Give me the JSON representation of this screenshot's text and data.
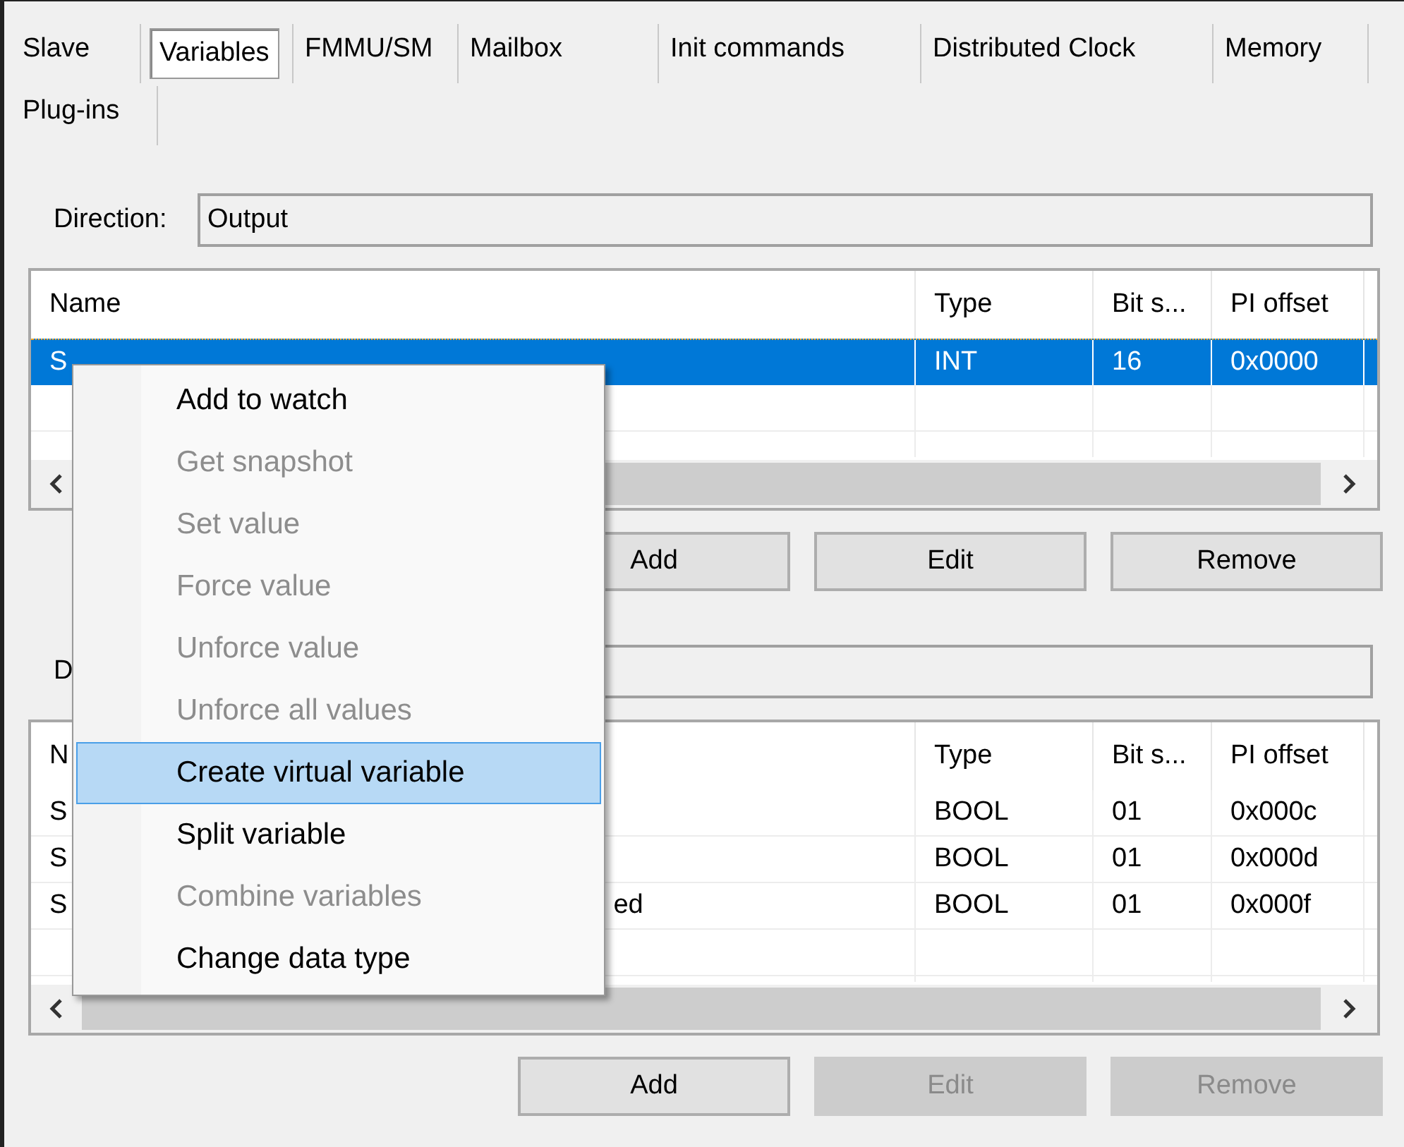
{
  "tab_rows": [
    [
      {
        "label": "Slave",
        "selected": false
      },
      {
        "label": "Variables",
        "selected": true
      },
      {
        "label": "FMMU/SM",
        "selected": false
      },
      {
        "label": "Mailbox",
        "selected": false
      },
      {
        "label": "Init commands",
        "selected": false
      },
      {
        "label": "Distributed Clock",
        "selected": false
      },
      {
        "label": "Memory",
        "selected": false
      }
    ],
    [
      {
        "label": "Plug-ins",
        "selected": false
      }
    ]
  ],
  "sections": [
    {
      "direction_label": "Direction:",
      "direction_value": "Output",
      "columns": [
        "Name",
        "Type",
        "Bit s...",
        "PI offset"
      ],
      "rows": [
        {
          "name": "S",
          "type": "INT",
          "bit_size": "16",
          "pi_offset": "0x0000",
          "selected": true
        }
      ],
      "buttons": [
        {
          "label": "Add",
          "disabled": false
        },
        {
          "label": "Edit",
          "disabled": false
        },
        {
          "label": "Remove",
          "disabled": false
        }
      ]
    },
    {
      "direction_label": "D",
      "columns": [
        "N",
        "Type",
        "Bit s...",
        "PI offset"
      ],
      "rows": [
        {
          "name": "S",
          "type": "BOOL",
          "bit_size": "01",
          "pi_offset": "0x000c",
          "selected": false
        },
        {
          "name": "S",
          "type": "BOOL",
          "bit_size": "01",
          "pi_offset": "0x000d",
          "selected": false
        },
        {
          "name": "S",
          "name_tail": "ed",
          "type": "BOOL",
          "bit_size": "01",
          "pi_offset": "0x000f",
          "selected": false
        }
      ],
      "buttons": [
        {
          "label": "Add",
          "disabled": false
        },
        {
          "label": "Edit",
          "disabled": true
        },
        {
          "label": "Remove",
          "disabled": true
        }
      ]
    }
  ],
  "context_menu": {
    "items": [
      {
        "label": "Add to watch",
        "disabled": false,
        "selected": false
      },
      {
        "label": "Get snapshot",
        "disabled": true,
        "selected": false
      },
      {
        "label": "Set value",
        "disabled": true,
        "selected": false
      },
      {
        "label": "Force value",
        "disabled": true,
        "selected": false
      },
      {
        "label": "Unforce value",
        "disabled": true,
        "selected": false
      },
      {
        "label": "Unforce all values",
        "disabled": true,
        "selected": false
      },
      {
        "label": "Create virtual variable",
        "disabled": false,
        "selected": true
      },
      {
        "label": "Split variable",
        "disabled": false,
        "selected": false
      },
      {
        "label": "Combine variables",
        "disabled": true,
        "selected": false
      },
      {
        "label": "Change data type",
        "disabled": false,
        "selected": false
      }
    ]
  }
}
